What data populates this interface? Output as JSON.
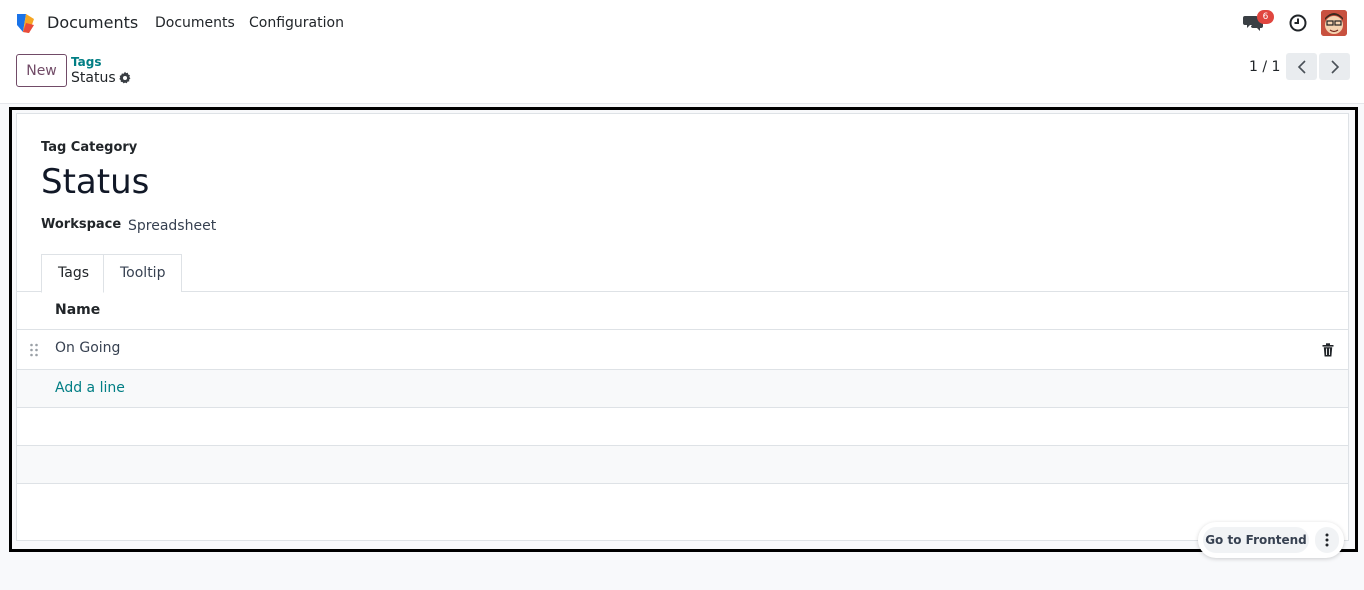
{
  "navbar": {
    "app_name": "Documents",
    "menu": [
      "Documents",
      "Configuration"
    ],
    "chat_badge": "6"
  },
  "control_panel": {
    "new_label": "New",
    "breadcrumb_parent": "Tags",
    "breadcrumb_current": "Status",
    "pager": "1 / 1"
  },
  "form": {
    "category_label": "Tag Category",
    "title": "Status",
    "workspace_label": "Workspace",
    "workspace_value": "Spreadsheet",
    "tabs": [
      "Tags",
      "Tooltip"
    ],
    "list": {
      "column": "Name",
      "rows": [
        "On Going"
      ],
      "add_line": "Add a line"
    }
  },
  "floating": {
    "frontend_label": "Go to Frontend"
  },
  "colors": {
    "brand": "#714b67",
    "link": "#017e84",
    "badge": "#e0463f"
  }
}
